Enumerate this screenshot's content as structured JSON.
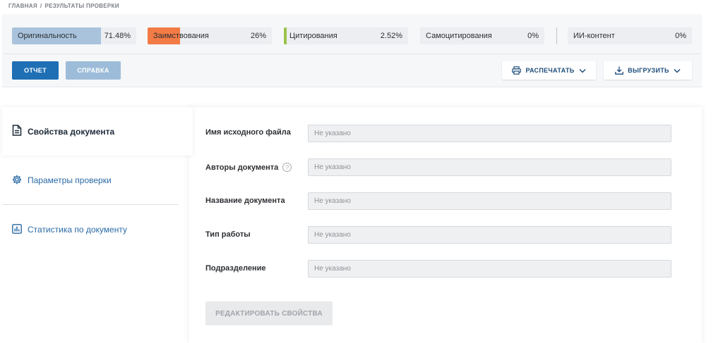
{
  "breadcrumb": {
    "home": "ГЛАВНАЯ",
    "separator": "/",
    "current": "РЕЗУЛЬТАТЫ ПРОВЕРКИ"
  },
  "metrics": [
    {
      "label": "Оригинальность",
      "value": "71.48%",
      "fill_fraction": 0.7148,
      "color": "#a9c3dc"
    },
    {
      "label": "Заимствования",
      "value": "26%",
      "fill_fraction": 0.26,
      "color": "#f37b45"
    },
    {
      "label": "Цитирования",
      "value": "2.52%",
      "fill_fraction": 0.0252,
      "color": "#9bc24a"
    },
    {
      "label": "Самоцитирования",
      "value": "0%",
      "fill_fraction": 0,
      "color": "#eceef1"
    },
    {
      "label": "ИИ-контент",
      "value": "0%",
      "fill_fraction": 0,
      "color": "#eceef1"
    }
  ],
  "toolbar": {
    "report_label": "ОТЧЕТ",
    "help_label": "СПРАВКА",
    "print_label": "РАСПЕЧАТАТЬ",
    "export_label": "ВЫГРУЗИТЬ",
    "print_icon": "printer-icon",
    "export_icon": "download-icon"
  },
  "sidebar": {
    "items": [
      {
        "label": "Свойства документа",
        "icon": "document-icon",
        "active": true
      },
      {
        "label": "Параметры проверки",
        "icon": "gear-icon",
        "active": false
      },
      {
        "label": "Статистика по документу",
        "icon": "bar-chart-icon",
        "active": false
      }
    ]
  },
  "form": {
    "fields": [
      {
        "label": "Имя исходного файла",
        "value": "Не указано"
      },
      {
        "label": "Авторы документа",
        "value": "Не указано",
        "help_icon": "?"
      },
      {
        "label": "Название документа",
        "value": "Не указано"
      },
      {
        "label": "Тип работы",
        "value": "Не указано"
      },
      {
        "label": "Подразделение",
        "value": "Не указано"
      }
    ],
    "edit_button_label": "РЕДАКТИРОВАТЬ СВОЙСТВА"
  },
  "colors": {
    "primary": "#1f6fb5",
    "primary_disabled": "#9dbcd9",
    "link": "#2a6aa6",
    "originality": "#a9c3dc",
    "borrowing": "#f37b45",
    "citation": "#9bc24a"
  }
}
